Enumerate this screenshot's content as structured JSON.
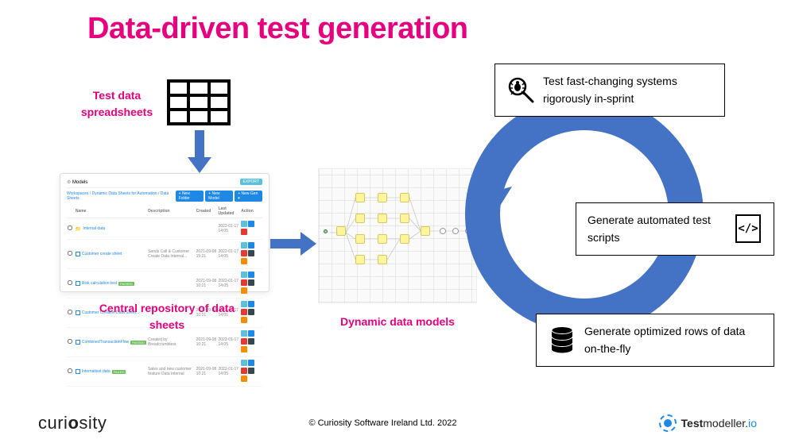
{
  "title": "Data-driven test generation",
  "labels": {
    "spreadsheets": "Test data spreadsheets",
    "repository": "Central repository of data sheets",
    "dynamic": "Dynamic data models"
  },
  "models_panel": {
    "header": "Models",
    "export": "EXPORT",
    "breadcrumb": "Workspaces / Dynamic Data Sheets for Automation / Data Sheets",
    "buttons": {
      "new_folder": "+ New Folder",
      "new_model": "+ New Model",
      "new_gen": "+ New Gen ▾"
    },
    "columns": [
      "Name",
      "Description",
      "Created",
      "Last Updated",
      "Action"
    ],
    "rows": [
      {
        "name": "Internal data",
        "folder": true,
        "desc": "",
        "created": "",
        "updated": "2022-01-17 14:05",
        "badge": ""
      },
      {
        "name": "Customer create sheet",
        "desc": "Sends Call & Customer Create Data Internal...",
        "created": "2021-09-08 15:21",
        "updated": "2022-01-17 14:05",
        "badge": ""
      },
      {
        "name": "Risk calculation test",
        "desc": "",
        "created": "2021-09-08 10:21",
        "updated": "2022-01-17 14:05",
        "badge": "PASSED"
      },
      {
        "name": "Customer Creation Data Sheet...",
        "desc": "",
        "created": "2021-09-08 10:21",
        "updated": "2022-01-17 14:05",
        "badge": ""
      },
      {
        "name": "CombinedTransactionFlow",
        "desc": "Created by Breadcrumbtest",
        "created": "2021-09-08 10:21",
        "updated": "2022-01-17 14:05",
        "badge": "PASSED"
      },
      {
        "name": "Internaltest data",
        "desc": "Sales and new customer feature Data Internal",
        "created": "2021-09-08 10:21",
        "updated": "2022-01-17 14:05",
        "badge": "FAILED"
      }
    ]
  },
  "info_boxes": {
    "box1": "Test fast-changing systems rigorously in-sprint",
    "box2": "Generate automated test scripts",
    "box3": "Generate optimized rows of data on-the-fly"
  },
  "footer": {
    "left": "curiosity",
    "center": "© Curiosity Software Ireland Ltd. 2022",
    "right": "Testmodeller.io"
  }
}
